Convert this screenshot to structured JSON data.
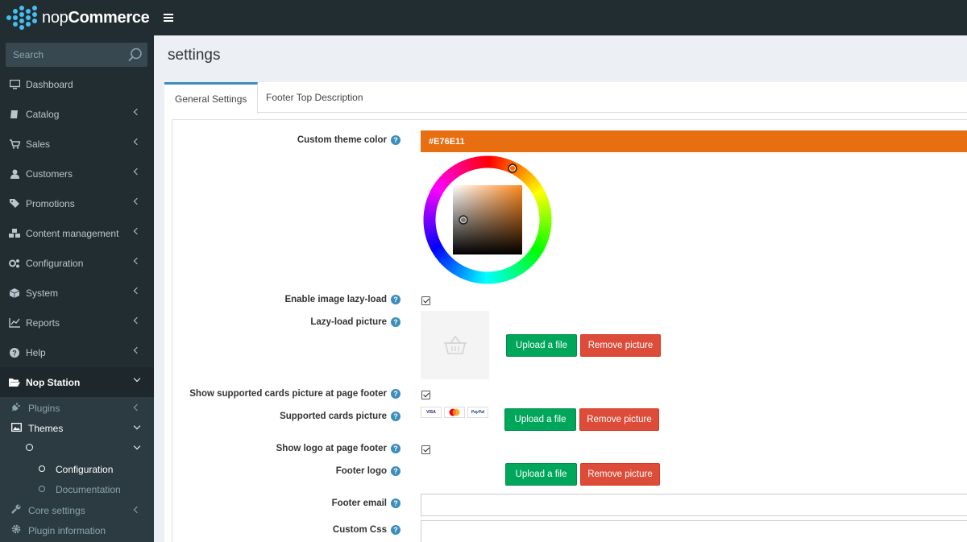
{
  "header": {
    "brand_light": "nop",
    "brand_bold": "Commerce"
  },
  "sidebar": {
    "search_placeholder": "Search",
    "items": [
      {
        "label": "Dashboard",
        "icon": "desktop-icon"
      },
      {
        "label": "Catalog",
        "icon": "book-icon"
      },
      {
        "label": "Sales",
        "icon": "cart-icon"
      },
      {
        "label": "Customers",
        "icon": "user-icon"
      },
      {
        "label": "Promotions",
        "icon": "tags-icon"
      },
      {
        "label": "Content management",
        "icon": "cubes-icon"
      },
      {
        "label": "Configuration",
        "icon": "gears-icon"
      },
      {
        "label": "System",
        "icon": "cube-icon"
      },
      {
        "label": "Reports",
        "icon": "line-chart-icon"
      },
      {
        "label": "Help",
        "icon": "question-icon"
      },
      {
        "label": "Nop Station",
        "icon": "folder-open-icon"
      }
    ],
    "sub_items": [
      {
        "label": "Plugins",
        "icon": "plug-icon"
      },
      {
        "label": "Themes",
        "icon": "image-icon"
      },
      {
        "label": "",
        "icon": "circle-icon"
      },
      {
        "label": "Configuration",
        "icon": "circle-icon"
      },
      {
        "label": "Documentation",
        "icon": "circle-icon"
      },
      {
        "label": "Core settings",
        "icon": "wrench-icon"
      },
      {
        "label": "Plugin information",
        "icon": "cog-icon"
      }
    ]
  },
  "page": {
    "title": "settings"
  },
  "tabs": [
    {
      "label": "General Settings"
    },
    {
      "label": "Footer Top Description"
    }
  ],
  "form": {
    "custom_theme_color_label": "Custom theme color",
    "custom_theme_color_value": "#E76E11",
    "theme_color": "#e76e11",
    "enable_lazy_load_label": "Enable image lazy-load",
    "lazy_load_picture_label": "Lazy-load picture",
    "show_cards_label": "Show supported cards picture at page footer",
    "supported_cards_label": "Supported cards picture",
    "cards": [
      "VISA",
      "MC",
      "PayPal"
    ],
    "show_logo_label": "Show logo at page footer",
    "footer_logo_label": "Footer logo",
    "footer_email_label": "Footer email",
    "footer_email_value": "",
    "custom_css_label": "Custom Css",
    "custom_css_value": "",
    "upload_label": "Upload a file",
    "remove_label": "Remove picture",
    "help_glyph": "?"
  }
}
